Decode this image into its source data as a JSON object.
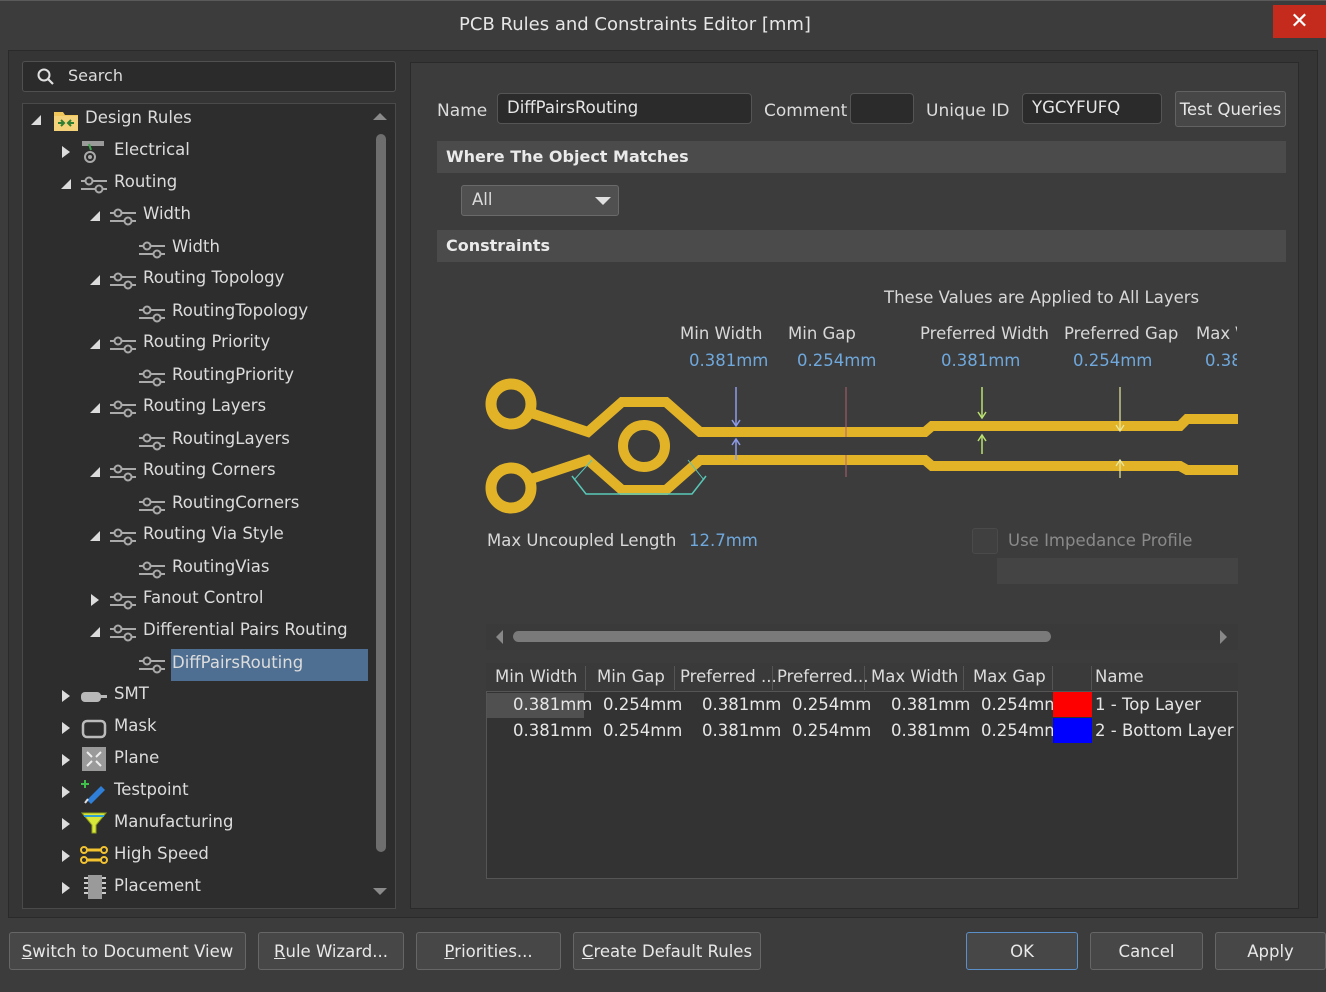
{
  "window": {
    "title": "PCB Rules and Constraints Editor [mm]",
    "close_glyph": "✕"
  },
  "search": {
    "placeholder": "Search"
  },
  "tree": {
    "root": "Design Rules",
    "items": [
      {
        "label": "Electrical"
      },
      {
        "label": "Routing"
      },
      {
        "label": "Width"
      },
      {
        "label": "Width"
      },
      {
        "label": "Routing Topology"
      },
      {
        "label": "RoutingTopology"
      },
      {
        "label": "Routing Priority"
      },
      {
        "label": "RoutingPriority"
      },
      {
        "label": "Routing Layers"
      },
      {
        "label": "RoutingLayers"
      },
      {
        "label": "Routing Corners"
      },
      {
        "label": "RoutingCorners"
      },
      {
        "label": "Routing Via Style"
      },
      {
        "label": "RoutingVias"
      },
      {
        "label": "Fanout Control"
      },
      {
        "label": "Differential Pairs Routing"
      },
      {
        "label": "DiffPairsRouting"
      },
      {
        "label": "SMT"
      },
      {
        "label": "Mask"
      },
      {
        "label": "Plane"
      },
      {
        "label": "Testpoint"
      },
      {
        "label": "Manufacturing"
      },
      {
        "label": "High Speed"
      },
      {
        "label": "Placement"
      }
    ]
  },
  "rule": {
    "name_label": "Name",
    "name_value": "DiffPairsRouting",
    "comment_label": "Comment",
    "comment_value": "",
    "uid_label": "Unique ID",
    "uid_value": "YGCYFUFQ",
    "test_queries": "Test Queries"
  },
  "where": {
    "title": "Where The Object Matches",
    "selected": "All"
  },
  "constraints": {
    "title": "Constraints",
    "applied_note": "These Values are Applied to All Layers",
    "params": [
      {
        "label": "Min Width",
        "value": "0.381mm"
      },
      {
        "label": "Min Gap",
        "value": "0.254mm"
      },
      {
        "label": "Preferred Width",
        "value": "0.381mm"
      },
      {
        "label": "Preferred Gap",
        "value": "0.254mm"
      },
      {
        "label": "Max \\",
        "value": "0.38"
      }
    ],
    "max_uncoupled_label": "Max Uncoupled Length",
    "max_uncoupled_value": "12.7mm",
    "impedance_label": "Use Impedance Profile"
  },
  "grid": {
    "headers": [
      "Min Width",
      "Min Gap",
      "Preferred ...",
      "Preferred...",
      "Max Width",
      "Max Gap",
      "",
      "Name"
    ],
    "rows": [
      {
        "cells": [
          "0.381mm",
          "0.254mm",
          "0.381mm",
          "0.254mm",
          "0.381mm",
          "0.254mm"
        ],
        "color": "#ff0000",
        "name": "1 - Top Layer"
      },
      {
        "cells": [
          "0.381mm",
          "0.254mm",
          "0.381mm",
          "0.254mm",
          "0.381mm",
          "0.254mm"
        ],
        "color": "#0000ff",
        "name": "2 - Bottom Layer"
      }
    ]
  },
  "footer": {
    "switch_view": {
      "accel": "S",
      "rest": "witch to Document View"
    },
    "rule_wizard": {
      "accel": "R",
      "rest": "ule Wizard..."
    },
    "priorities": {
      "accel": "P",
      "rest": "riorities..."
    },
    "create_default": {
      "accel": "C",
      "rest": "reate Default Rules"
    },
    "ok": "OK",
    "cancel": "Cancel",
    "apply": "Apply"
  },
  "colors": {
    "trace": "#e3b327",
    "selection": "#4e6f92",
    "accent_value": "#6fa8dc"
  }
}
